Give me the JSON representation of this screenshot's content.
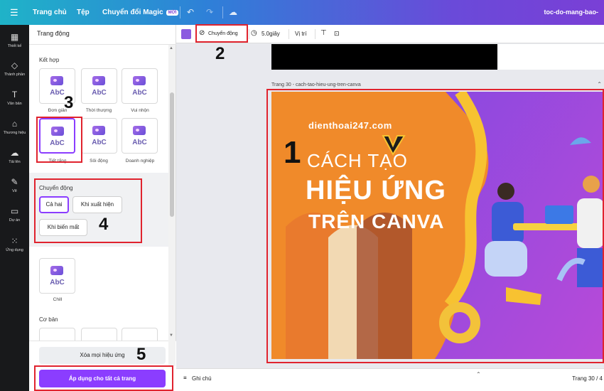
{
  "topbar": {
    "home": "Trang chủ",
    "file": "Tệp",
    "magic": "Chuyển đổi Magic",
    "badge": "MỚI",
    "doc_title": "toc-do-mang-bao-"
  },
  "rail": [
    {
      "label": "Thiết kế",
      "icon": "layout-icon"
    },
    {
      "label": "Thành phần",
      "icon": "shapes-icon"
    },
    {
      "label": "Văn bản",
      "icon": "text-icon"
    },
    {
      "label": "Thương hiệu",
      "icon": "brand-icon"
    },
    {
      "label": "Tải lên",
      "icon": "upload-icon"
    },
    {
      "label": "Vẽ",
      "icon": "draw-icon"
    },
    {
      "label": "Dự án",
      "icon": "folder-icon"
    },
    {
      "label": "Ứng dụng",
      "icon": "apps-icon"
    }
  ],
  "panel": {
    "title": "Trang động",
    "section_combo": "Kết hợp",
    "tiles_row1": [
      "Đơn giản",
      "Thời thượng",
      "Vui nhộn"
    ],
    "tiles_row2": [
      "Tiết tấng",
      "Sôi động",
      "Doanh nghiệp"
    ],
    "tile_glyph": "AbC",
    "motion_label": "Chuyển động",
    "motion_options": [
      "Cả hai",
      "Khi xuất hiện",
      "Khi biến mất"
    ],
    "chill": "Chill",
    "section_basic": "Cơ bản",
    "clear_all": "Xóa mọi hiệu ứng",
    "apply_all": "Áp dụng cho tất cả trang"
  },
  "toolbar": {
    "animate": "Chuyển động",
    "duration": "5.0giây",
    "position": "Vị trí",
    "swatch_color": "#8b5be0"
  },
  "canvas": {
    "page_label": "Trang 30 - cach-tao-hieu-ung-tren-canva",
    "site": "dienthoai247.com",
    "line1": "CÁCH TẠO",
    "line2": "HIỆU ỨNG",
    "line3": "TRÊN CANVA"
  },
  "footer": {
    "notes": "Ghi chú",
    "pager": "Trang 30 / 4"
  },
  "annotations": [
    "1",
    "2",
    "3",
    "4",
    "5"
  ],
  "colors": {
    "accent": "#8b3dff",
    "annotation": "#e0232e"
  }
}
